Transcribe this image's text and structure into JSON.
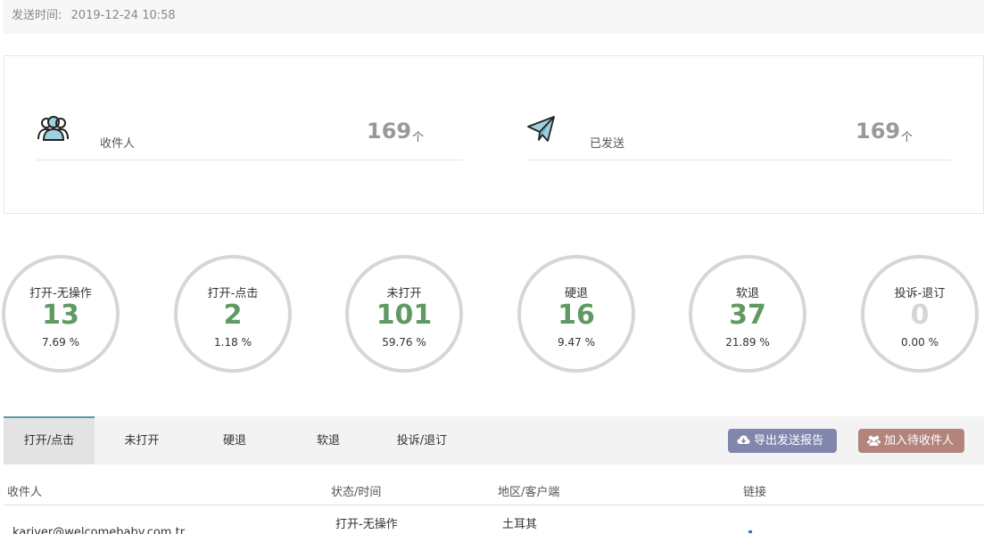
{
  "header": {
    "send_time_label": "发送时间:",
    "send_time_value": "2019-12-24 10:58"
  },
  "summary": {
    "recipients": {
      "label": "收件人",
      "value": "169",
      "unit": "个",
      "icon": "users-icon"
    },
    "sent": {
      "label": "已发送",
      "value": "169",
      "unit": "个",
      "icon": "paper-plane-icon"
    }
  },
  "stats": [
    {
      "label": "打开-无操作",
      "count": "13",
      "percent": "7.69 %"
    },
    {
      "label": "打开-点击",
      "count": "2",
      "percent": "1.18 %"
    },
    {
      "label": "未打开",
      "count": "101",
      "percent": "59.76 %"
    },
    {
      "label": "硬退",
      "count": "16",
      "percent": "9.47 %"
    },
    {
      "label": "软退",
      "count": "37",
      "percent": "21.89 %"
    },
    {
      "label": "投诉-退订",
      "count": "0",
      "percent": "0.00 %"
    }
  ],
  "tabs": [
    {
      "label": "打开/点击",
      "active": true
    },
    {
      "label": "未打开"
    },
    {
      "label": "硬退"
    },
    {
      "label": "软退"
    },
    {
      "label": "投诉/退订"
    }
  ],
  "buttons": {
    "export": {
      "label": "导出发送报告",
      "icon": "cloud-download-icon"
    },
    "add": {
      "label": "加入待收件人",
      "icon": "users-icon"
    }
  },
  "colors": {
    "count_green": "#5f9a62",
    "count_zero": "#d6d6d6",
    "export_button": "#8186ad",
    "add_button": "#b3847c",
    "active_tab_border": "#5b9ba0"
  },
  "table": {
    "columns": [
      "收件人",
      "状态/时间",
      "地区/客户端",
      "链接"
    ],
    "rows": [
      {
        "recipient": "kariyer@welcomebaby.com.tr",
        "status": "打开-无操作",
        "region": "土耳其"
      }
    ]
  }
}
